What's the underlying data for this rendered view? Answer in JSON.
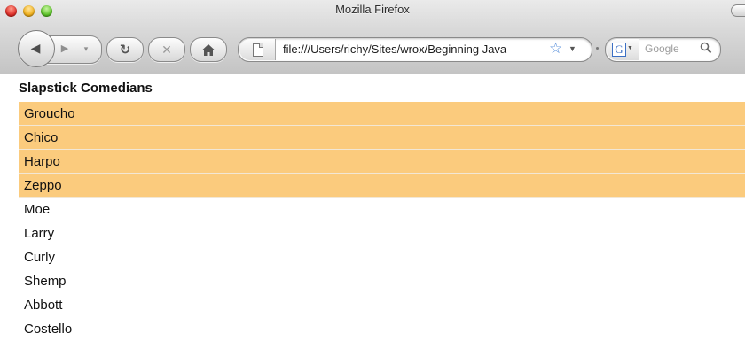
{
  "window": {
    "title": "Mozilla Firefox"
  },
  "toolbar": {
    "url": "file:///Users/richy/Sites/wrox/Beginning Java",
    "search_placeholder": "Google"
  },
  "page": {
    "heading": "Slapstick Comedians",
    "highlight_color": "#fbcb7d",
    "items": [
      {
        "label": "Groucho",
        "highlighted": true
      },
      {
        "label": "Chico",
        "highlighted": true
      },
      {
        "label": "Harpo",
        "highlighted": true
      },
      {
        "label": "Zeppo",
        "highlighted": true
      },
      {
        "label": "Moe",
        "highlighted": false
      },
      {
        "label": "Larry",
        "highlighted": false
      },
      {
        "label": "Curly",
        "highlighted": false
      },
      {
        "label": "Shemp",
        "highlighted": false
      },
      {
        "label": "Abbott",
        "highlighted": false
      },
      {
        "label": "Costello",
        "highlighted": false
      }
    ]
  },
  "icons": {
    "back": "back-arrow-icon",
    "forward": "forward-arrow-icon",
    "reload": "reload-icon",
    "stop": "stop-icon",
    "home": "home-icon",
    "bookmark": "star-icon",
    "search": "magnifier-icon"
  }
}
